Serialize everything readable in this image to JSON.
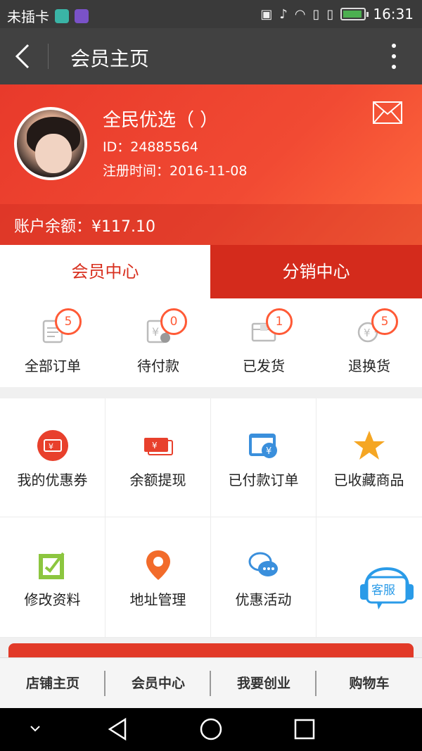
{
  "status_bar": {
    "carrier": "未插卡",
    "icons": [
      "nfc-icon",
      "mute-icon",
      "wifi-icon",
      "sim-icon",
      "sim2-icon",
      "battery-charging-icon"
    ],
    "time": "16:31"
  },
  "app_bar": {
    "title": "会员主页"
  },
  "profile": {
    "name": "全民优选（ ）",
    "id_text": "ID：24885564",
    "register_time": "注册时间：2016-11-08",
    "balance": "账户余额：¥117.10"
  },
  "tabs": [
    {
      "label": "会员中心",
      "active": true
    },
    {
      "label": "分销中心",
      "active": false
    }
  ],
  "orders": [
    {
      "label": "全部订单",
      "count": "5",
      "icon": "all-orders-icon"
    },
    {
      "label": "待付款",
      "count": "0",
      "icon": "pending-payment-icon"
    },
    {
      "label": "已发货",
      "count": "1",
      "icon": "shipped-icon"
    },
    {
      "label": "退换货",
      "count": "5",
      "icon": "return-icon"
    }
  ],
  "grid": [
    {
      "label": "我的优惠券",
      "icon": "coupon-icon"
    },
    {
      "label": "余额提现",
      "icon": "withdraw-icon"
    },
    {
      "label": "已付款订单",
      "icon": "paid-orders-icon"
    },
    {
      "label": "已收藏商品",
      "icon": "star-icon"
    },
    {
      "label": "修改资料",
      "icon": "edit-icon"
    },
    {
      "label": "地址管理",
      "icon": "location-icon"
    },
    {
      "label": "优惠活动",
      "icon": "chat-icon"
    }
  ],
  "service": {
    "label": "客服"
  },
  "bottom_nav": [
    {
      "label": "店铺主页"
    },
    {
      "label": "会员中心"
    },
    {
      "label": "我要创业"
    },
    {
      "label": "购物车"
    }
  ],
  "colors": {
    "brand_red": "#e83a2b",
    "badge_orange": "#ff5a36",
    "service_blue": "#2a9be8"
  }
}
